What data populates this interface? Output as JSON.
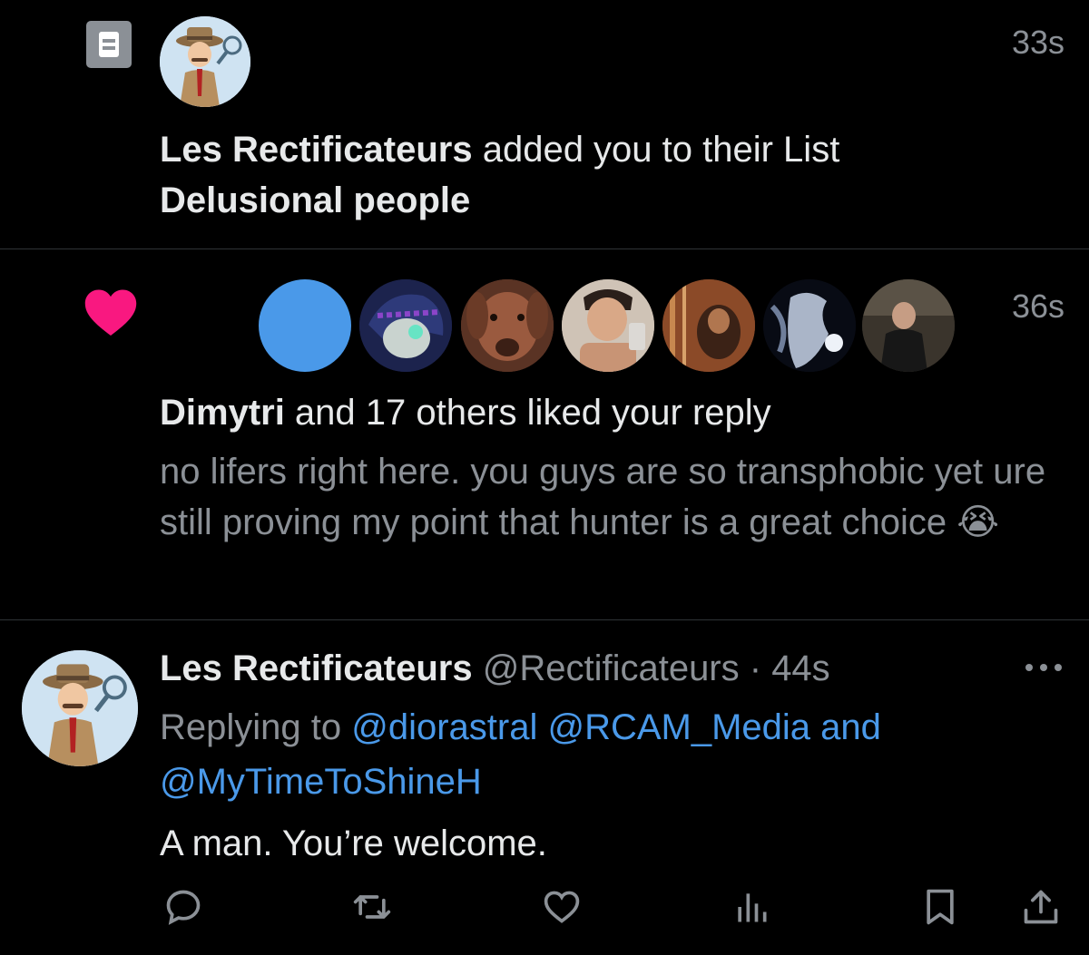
{
  "list_notification": {
    "icon": "list-icon",
    "actor": "Les Rectificateurs",
    "action_text": " added you to their List",
    "list_name": "Delusional people",
    "time": "33s"
  },
  "like_notification": {
    "icon": "heart-icon",
    "time": "36s",
    "actor": "Dimytri",
    "action_text": " and 17 others liked your reply",
    "reply_text": "no lifers right here. you guys are so transphobic yet ure still proving my point that hunter is a great choice 😭",
    "accent_color": "#f91880"
  },
  "tweet": {
    "display_name": "Les Rectificateurs",
    "handle": "@Rectificateurs",
    "separator": " · ",
    "time": "44s",
    "replying_prefix": "Replying to ",
    "replying_mentions": "@diorastral @RCAM_Media and @MyTimeToShineH",
    "body": "A man. You’re welcome.",
    "link_color": "#4a99e9",
    "actions": [
      "reply-icon",
      "retweet-icon",
      "like-icon",
      "views-icon",
      "bookmark-icon",
      "share-icon"
    ]
  }
}
